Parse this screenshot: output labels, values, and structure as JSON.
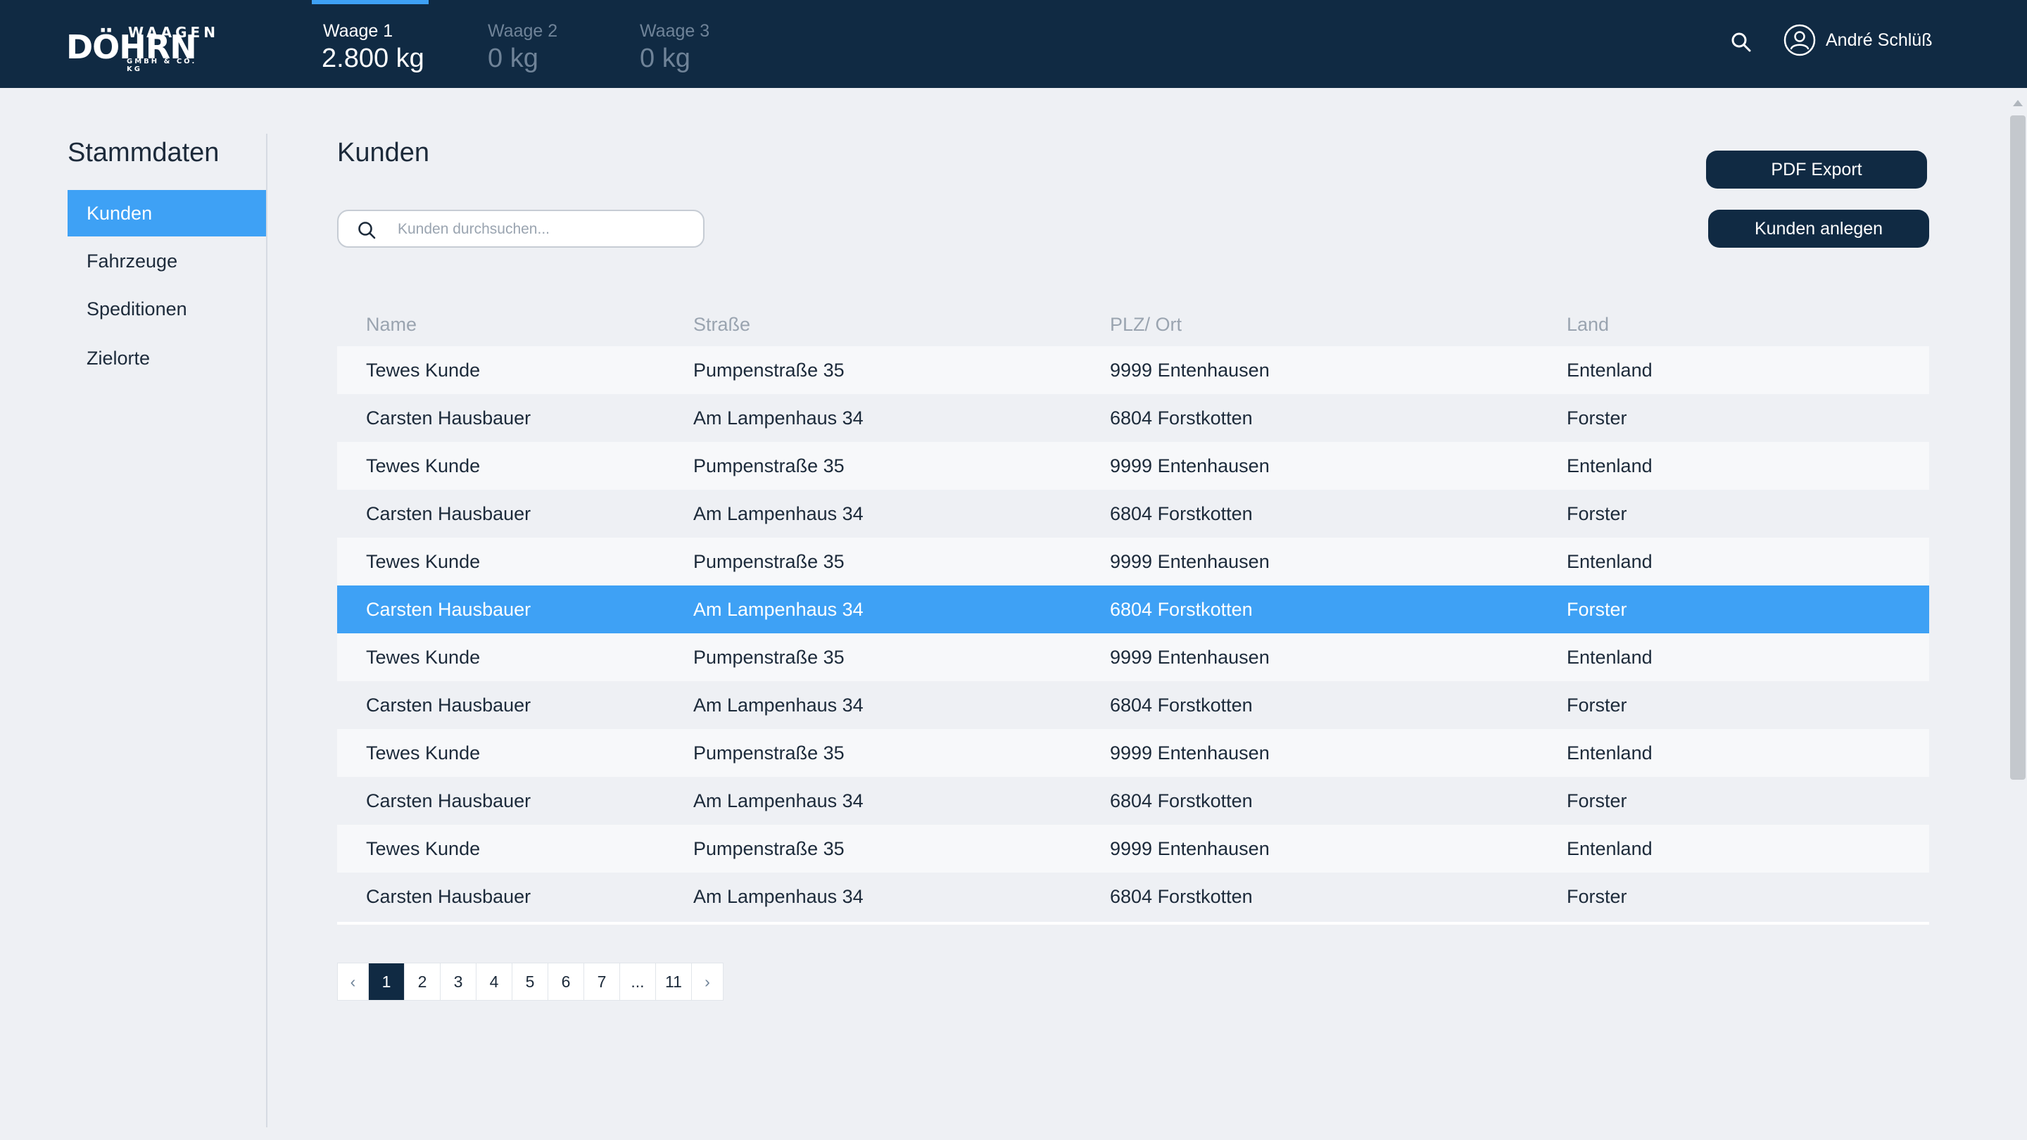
{
  "brand": {
    "top": "WAAGEN",
    "main": "DÖHRN",
    "sub": "GMBH & CO. KG"
  },
  "scales": [
    {
      "name": "Waage 1",
      "value": "2.800 kg"
    },
    {
      "name": "Waage 2",
      "value": "0 kg"
    },
    {
      "name": "Waage 3",
      "value": "0 kg"
    }
  ],
  "header": {
    "user_name": "André Schlüß",
    "search_icon": "search-icon",
    "user_icon": "user-circle-icon"
  },
  "sidebar": {
    "title": "Stammdaten",
    "items": [
      {
        "label": "Kunden"
      },
      {
        "label": "Fahrzeuge"
      },
      {
        "label": "Speditionen"
      },
      {
        "label": "Zielorte"
      }
    ]
  },
  "main": {
    "title": "Kunden",
    "pdf_button": "PDF Export",
    "create_button": "Kunden anlegen",
    "search_placeholder": "Kunden durchsuchen..."
  },
  "table": {
    "columns": [
      "Name",
      "Straße",
      "PLZ/ Ort",
      "Land"
    ],
    "selected_row": 5,
    "rows": [
      [
        "Tewes Kunde",
        "Pumpenstraße 35",
        "9999 Entenhausen",
        "Entenland"
      ],
      [
        "Carsten Hausbauer",
        "Am Lampenhaus 34",
        "6804 Forstkotten",
        "Forster"
      ],
      [
        "Tewes Kunde",
        "Pumpenstraße 35",
        "9999 Entenhausen",
        "Entenland"
      ],
      [
        "Carsten Hausbauer",
        "Am Lampenhaus 34",
        "6804 Forstkotten",
        "Forster"
      ],
      [
        "Tewes Kunde",
        "Pumpenstraße 35",
        "9999 Entenhausen",
        "Entenland"
      ],
      [
        "Carsten Hausbauer",
        "Am Lampenhaus 34",
        "6804 Forstkotten",
        "Forster"
      ],
      [
        "Tewes Kunde",
        "Pumpenstraße 35",
        "9999 Entenhausen",
        "Entenland"
      ],
      [
        "Carsten Hausbauer",
        "Am Lampenhaus 34",
        "6804 Forstkotten",
        "Forster"
      ],
      [
        "Tewes Kunde",
        "Pumpenstraße 35",
        "9999 Entenhausen",
        "Entenland"
      ],
      [
        "Carsten Hausbauer",
        "Am Lampenhaus 34",
        "6804 Forstkotten",
        "Forster"
      ],
      [
        "Tewes Kunde",
        "Pumpenstraße 35",
        "9999 Entenhausen",
        "Entenland"
      ],
      [
        "Carsten Hausbauer",
        "Am Lampenhaus 34",
        "6804 Forstkotten",
        "Forster"
      ]
    ]
  },
  "pagination": {
    "prev": "‹",
    "next": "›",
    "pages": [
      "1",
      "2",
      "3",
      "4",
      "5",
      "6",
      "7",
      "...",
      "11"
    ],
    "current": "1"
  },
  "colors": {
    "navy": "#102a43",
    "accent": "#3ea1f5",
    "background": "#eef0f4"
  }
}
